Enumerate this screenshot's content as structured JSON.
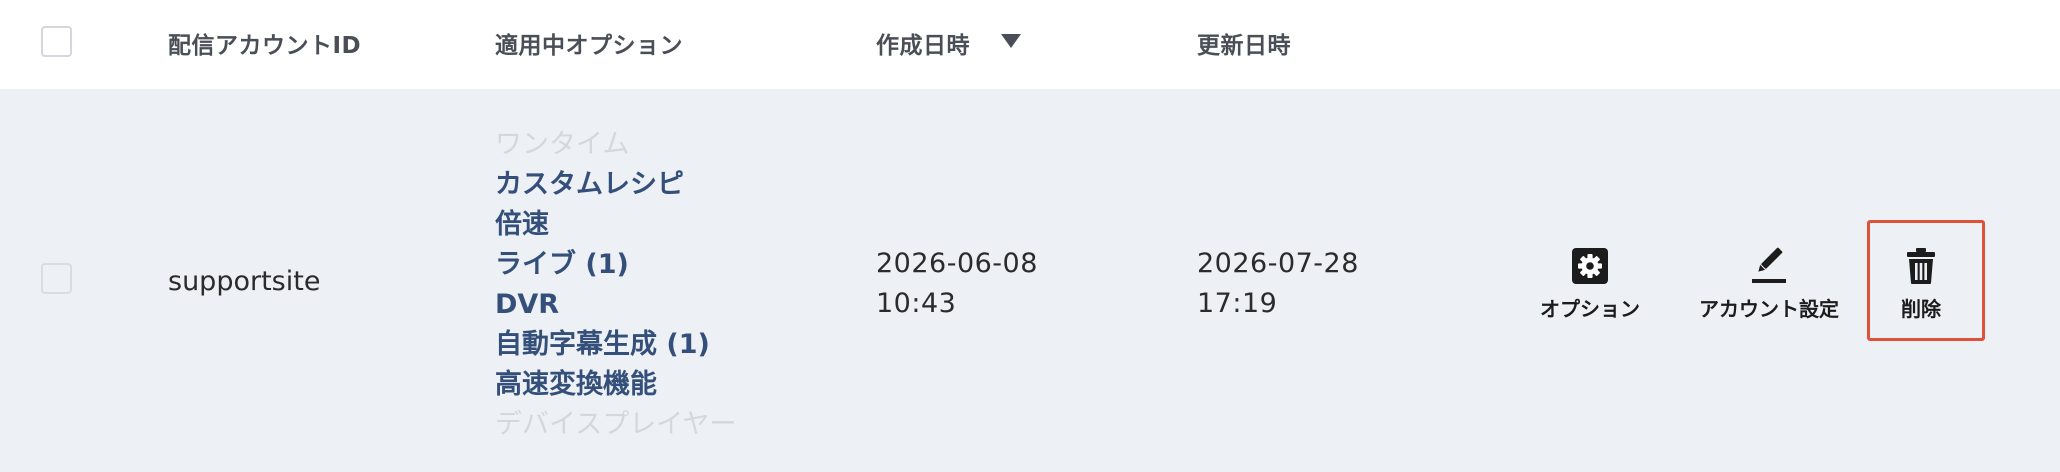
{
  "header": {
    "col_account_id": "配信アカウントID",
    "col_options": "適用中オプション",
    "col_created": "作成日時",
    "col_updated": "更新日時"
  },
  "row": {
    "account_id": "supportsite",
    "options": [
      {
        "label": "ワンタイム",
        "active": false
      },
      {
        "label": "カスタムレシピ",
        "active": true
      },
      {
        "label": "倍速",
        "active": true
      },
      {
        "label": "ライブ (1)",
        "active": true
      },
      {
        "label": "DVR",
        "active": true
      },
      {
        "label": "自動字幕生成 (1)",
        "active": true
      },
      {
        "label": "高速変換機能",
        "active": true
      },
      {
        "label": "デバイスプレイヤー",
        "active": false
      }
    ],
    "created_date": "2026-06-08",
    "created_time": "10:43",
    "updated_date": "2026-07-28",
    "updated_time": "17:19",
    "actions": {
      "options_label": "オプション",
      "options_icon": "gear-icon",
      "account_settings_label": "アカウント設定",
      "account_settings_icon": "pencil-icon",
      "delete_label": "削除",
      "delete_icon": "trash-icon"
    }
  },
  "colors": {
    "active_option": "#34507a",
    "inactive_option": "#d4d8de",
    "row_background": "#edf0f5",
    "highlight_border": "#e0513a"
  }
}
